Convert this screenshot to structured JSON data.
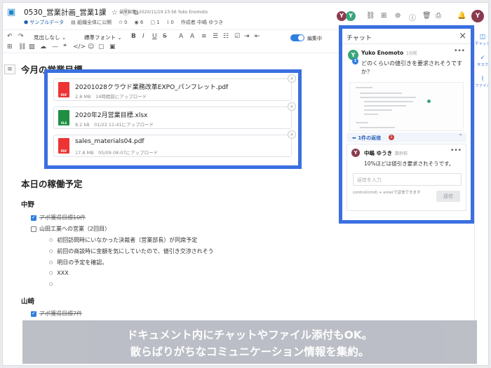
{
  "header": {
    "title": "0530_営業計画_営業1課",
    "edit_meta": "最終編集: 2020/11/19 23:56 Yuko Enomoto",
    "tag": "サンプルデータ",
    "share": "組織全体に公開",
    "stats": [
      "0",
      "6",
      "1",
      "0"
    ],
    "author": "作成者 中嶋 ゆうき",
    "avatars": [
      "Y",
      "Y"
    ],
    "user_avatar": "Y"
  },
  "toolbar": {
    "heading_select": "見出しなし",
    "font_select": "標準フォント",
    "edit_mode_label": "編集中"
  },
  "doc": {
    "heading1": "今月の営業目標",
    "heading2": "本日の稼働予定",
    "attachments": [
      {
        "name": "20201028クラウド業務改革EXPO_パンフレット.pdf",
        "meta": "2.8 MB　14時間前にアップロード",
        "type": "PDF"
      },
      {
        "name": "2020年2月営業目標.xlsx",
        "meta": "8.2 kB　01/22 11:41にアップロード",
        "type": "XLS"
      },
      {
        "name": "sales_materials04.pdf",
        "meta": "17.8 MB　05/09 08:07にアップロード",
        "type": "PDF"
      }
    ],
    "persons": [
      "中野",
      "山崎"
    ],
    "tasks_nakano": [
      {
        "text": "アポ獲得目標10件",
        "done": true
      },
      {
        "text": "山田工業への営業（2回目）",
        "done": false
      }
    ],
    "bullets": [
      "初回訪問時にいなかった決裁者（営業部長）が同席予定",
      "前回の商談時に金額を気にしていたので、値引き交渉されそう",
      "明日の予定を確認。",
      "XXX",
      ""
    ],
    "task_yamazaki": "アポ獲得目標7件"
  },
  "chat": {
    "title": "チャット",
    "message": {
      "author": "Yuko Enomoto",
      "time": "1分前",
      "avatar": "Y",
      "badge": "1",
      "text": "どのくらいの値引きを要求されそうですか？"
    },
    "reply_label": "1件の返信",
    "reply_count": "1",
    "reply": {
      "author": "中嶋 ゆうき",
      "time": "数秒前",
      "avatar": "Y",
      "text": "10%ほどは値引き要求されそうです。"
    },
    "input_placeholder": "返信を入力",
    "hint": "control(cmd) + enterで返信できます",
    "send_label": "送信"
  },
  "rail": [
    {
      "label": "チャット",
      "icon": "chat-icon"
    },
    {
      "label": "タスク",
      "icon": "check-icon"
    },
    {
      "label": "ファイル",
      "icon": "clip-icon"
    }
  ],
  "caption": {
    "line1": "ドキュメント内にチャットやファイル添付もOK。",
    "line2": "散らばりがちなコミュニケーション情報を集約。"
  },
  "colors": {
    "accent": "#3a6fe0",
    "avatar_purple": "#8b3a4f",
    "avatar_green": "#3aa57a"
  }
}
